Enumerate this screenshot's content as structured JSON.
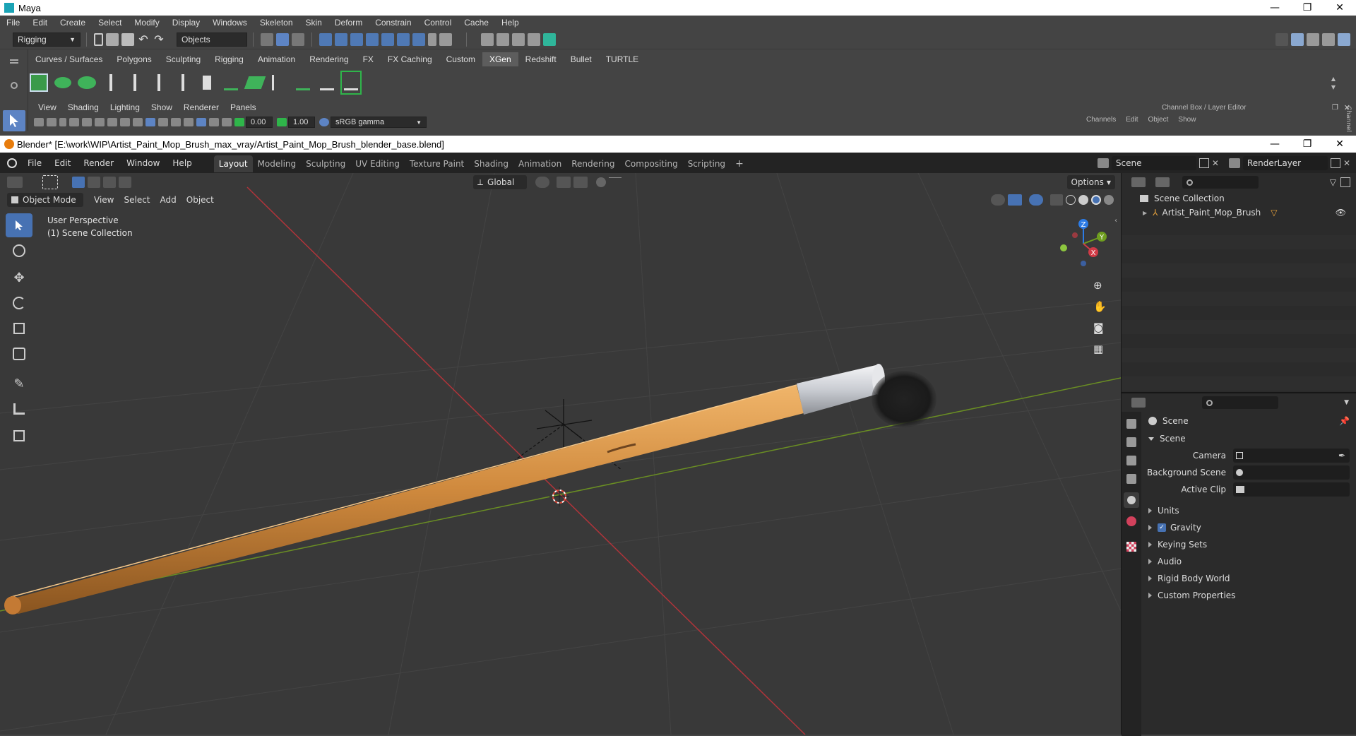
{
  "maya": {
    "title": "Maya",
    "menu": [
      "File",
      "Edit",
      "Create",
      "Select",
      "Modify",
      "Display",
      "Windows",
      "Skeleton",
      "Skin",
      "Deform",
      "Constrain",
      "Control",
      "Cache",
      "Help"
    ],
    "mode_dropdown": "Rigging",
    "objects_field": "Objects",
    "shelf_tabs": [
      "Curves / Surfaces",
      "Polygons",
      "Sculpting",
      "Rigging",
      "Animation",
      "Rendering",
      "FX",
      "FX Caching",
      "Custom",
      "XGen",
      "Redshift",
      "Bullet",
      "TURTLE"
    ],
    "active_shelf_tab": "XGen",
    "view_menu": [
      "View",
      "Shading",
      "Lighting",
      "Show",
      "Renderer",
      "Panels"
    ],
    "exposure_value": "0.00",
    "gamma_value": "1.00",
    "color_space": "sRGB gamma",
    "channel_box_title": "Channel Box / Layer Editor",
    "channel_box_menu": [
      "Channels",
      "Edit",
      "Object",
      "Show"
    ],
    "side_tab": "Channel"
  },
  "blender": {
    "title": "Blender* [E:\\work\\WIP\\Artist_Paint_Mop_Brush_max_vray/Artist_Paint_Mop_Brush_blender_base.blend]",
    "menu": [
      "File",
      "Edit",
      "Render",
      "Window",
      "Help"
    ],
    "workspaces": [
      "Layout",
      "Modeling",
      "Sculpting",
      "UV Editing",
      "Texture Paint",
      "Shading",
      "Animation",
      "Rendering",
      "Compositing",
      "Scripting"
    ],
    "active_workspace": "Layout",
    "scene_name": "Scene",
    "render_layer": "RenderLayer",
    "viewport": {
      "mode": "Object Mode",
      "menu": [
        "View",
        "Select",
        "Add",
        "Object"
      ],
      "transform_orientation": "Global",
      "options_label": "Options",
      "overlay_line1": "User Perspective",
      "overlay_line2": "(1) Scene Collection",
      "gizmo_axes": {
        "z": "Z",
        "y": "Y",
        "x": "X"
      }
    },
    "outliner": {
      "root": "Scene Collection",
      "items": [
        {
          "name": "Artist_Paint_Mop_Brush"
        }
      ]
    },
    "properties": {
      "header": "Scene",
      "section": "Scene",
      "fields": [
        {
          "label": "Camera",
          "value": ""
        },
        {
          "label": "Background Scene",
          "value": ""
        },
        {
          "label": "Active Clip",
          "value": ""
        }
      ],
      "panels": [
        "Units",
        "Gravity",
        "Keying Sets",
        "Audio",
        "Rigid Body World",
        "Custom Properties"
      ],
      "gravity_checked": true
    }
  },
  "colors": {
    "active_blue": "#4772b3",
    "maya_bg": "#444444",
    "blender_header": "#232323",
    "brush_wood": "#c8843a",
    "axis_red": "#b0343a",
    "axis_green": "#6a8e23"
  }
}
